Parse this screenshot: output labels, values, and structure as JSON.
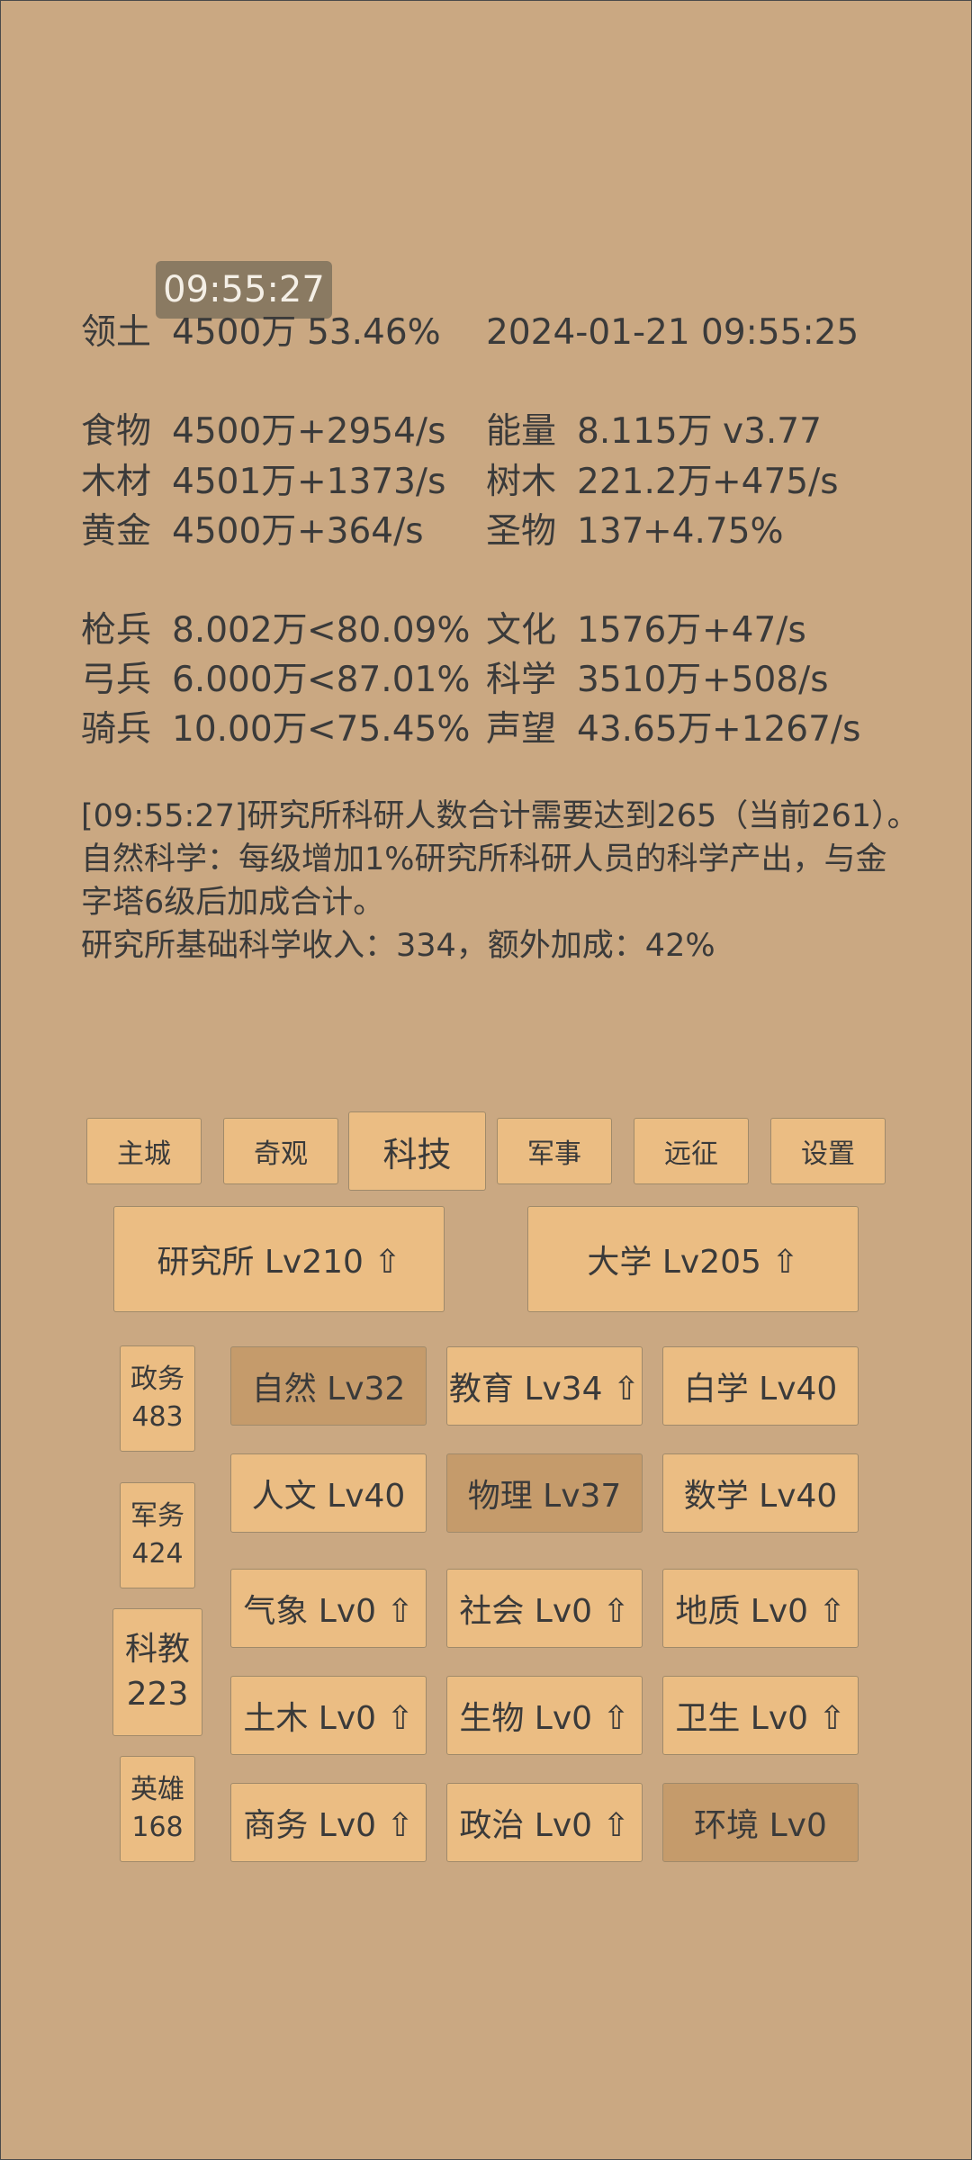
{
  "clock": "09:55:27",
  "stats": {
    "territory": {
      "label": "领土",
      "value": "4500万",
      "pct": "53.46%"
    },
    "datetime": "2024-01-21 09:55:25",
    "food": {
      "label": "食物",
      "value": "4500万",
      "rate": "+2954/s"
    },
    "wood": {
      "label": "木材",
      "value": "4501万",
      "rate": "+1373/s"
    },
    "gold": {
      "label": "黄金",
      "value": "4500万",
      "rate": "+364/s"
    },
    "energy": {
      "label": "能量",
      "value": "8.115万",
      "extra": "v3.77"
    },
    "trees": {
      "label": "树木",
      "value": "221.2万",
      "rate": "+475/s"
    },
    "relic": {
      "label": "圣物",
      "value": "137",
      "rate": "+4.75%"
    },
    "spear": {
      "label": "枪兵",
      "value": "8.002万",
      "pct": "<80.09%"
    },
    "archer": {
      "label": "弓兵",
      "value": "6.000万",
      "pct": "<87.01%"
    },
    "cavalry": {
      "label": "骑兵",
      "value": "10.00万",
      "pct": "<75.45%"
    },
    "culture": {
      "label": "文化",
      "value": "1576万",
      "rate": "+47/s"
    },
    "science": {
      "label": "科学",
      "value": "3510万",
      "rate": "+508/s"
    },
    "prestige": {
      "label": "声望",
      "value": "43.65万",
      "rate": "+1267/s"
    }
  },
  "message": {
    "line1": "[09:55:27]研究所科研人数合计需要达到265（当前261）。",
    "line2": "自然科学：每级增加1%研究所科研人员的科学产出，与金",
    "line3": "字塔6级后加成合计。",
    "line4": "研究所基础科学收入：334，额外加成：42%"
  },
  "tabs": [
    "主城",
    "奇观",
    "科技",
    "军事",
    "远征",
    "设置"
  ],
  "active_tab": "科技",
  "buildings": {
    "institute": "研究所 Lv210 ⇧",
    "university": "大学 Lv205 ⇧"
  },
  "side": [
    {
      "label": "政务",
      "count": "483"
    },
    {
      "label": "军务",
      "count": "424"
    },
    {
      "label": "科教",
      "count": "223"
    },
    {
      "label": "英雄",
      "count": "168"
    }
  ],
  "techs": [
    "自然 Lv32",
    "教育 Lv34 ⇧",
    "白学 Lv40",
    "人文 Lv40",
    "物理 Lv37",
    "数学 Lv40",
    "气象 Lv0 ⇧",
    "社会 Lv0 ⇧",
    "地质 Lv0 ⇧",
    "土木 Lv0 ⇧",
    "生物 Lv0 ⇧",
    "卫生 Lv0 ⇧",
    "商务 Lv0 ⇧",
    "政治 Lv0 ⇧",
    "环境 Lv0"
  ],
  "colors": {
    "background": "#caa882",
    "button": "#ebbd83",
    "button_active": "#c59b6b",
    "clock_bg": "#8a7a62"
  }
}
